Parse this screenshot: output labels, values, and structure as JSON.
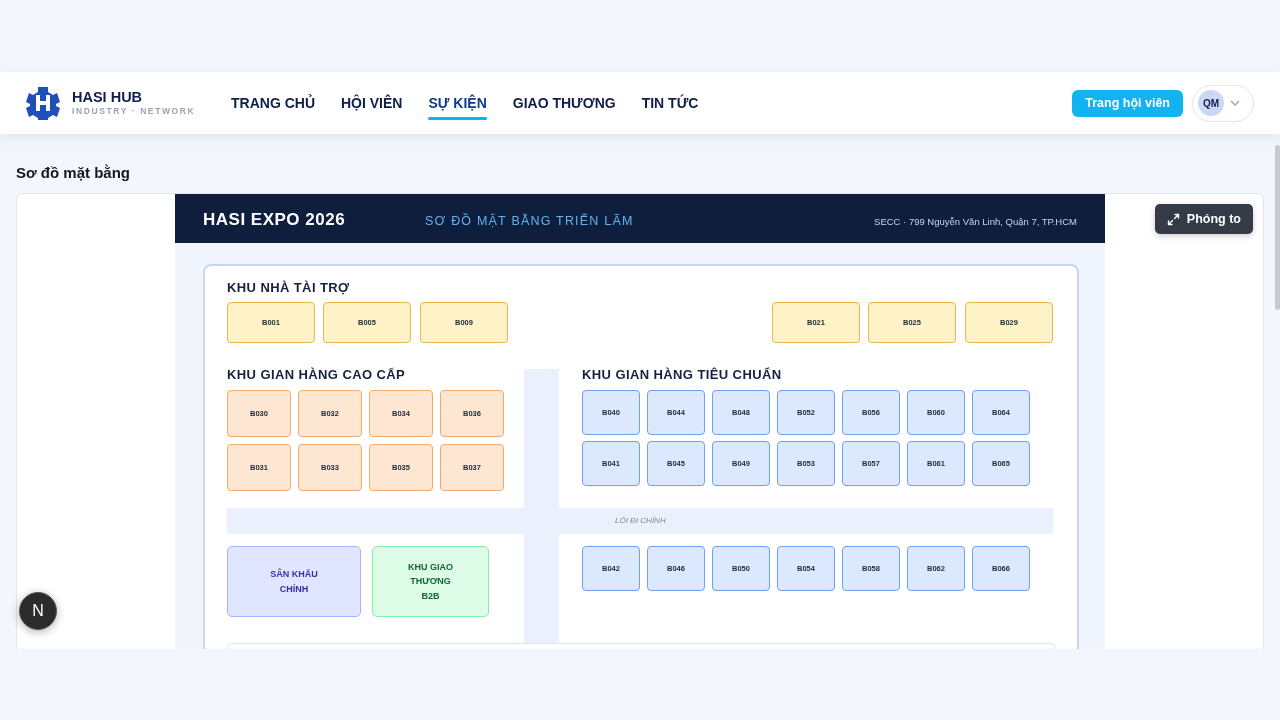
{
  "header": {
    "brand": "HASI HUB",
    "tagline": "INDUSTRY · NETWORK",
    "nav": [
      {
        "label": "TRANG CHỦ",
        "selected": false
      },
      {
        "label": "HỘI VIÊN",
        "selected": false
      },
      {
        "label": "SỰ KIỆN",
        "selected": true
      },
      {
        "label": "GIAO THƯƠNG",
        "selected": false
      },
      {
        "label": "TIN TỨC",
        "selected": false
      }
    ],
    "member_button": "Trang hội viên",
    "avatar": "QM"
  },
  "section_title": "Sơ đồ mặt bằng",
  "zoom_button": "Phóng to",
  "floor_plan": {
    "title": "HASI EXPO 2026",
    "subtitle": "SƠ ĐỒ MẶT BẰNG TRIỂN LÃM",
    "address": "SECC · 799 Nguyễn Văn Linh, Quận 7, TP.HCM",
    "zones": [
      {
        "kind": "sponsor",
        "title": "KHU NHÀ TÀI TRỢ",
        "booths": [
          "B001",
          "B005",
          "B009",
          "B021",
          "B025",
          "B029"
        ]
      },
      {
        "kind": "premium",
        "title": "KHU GIAN HÀNG CAO CẤP",
        "booths": [
          "B030",
          "B032",
          "B034",
          "B036",
          "B031",
          "B033",
          "B035",
          "B037"
        ]
      },
      {
        "kind": "standard",
        "title": "KHU GIAN HÀNG TIÊU CHUẨN",
        "booths": [
          "B040",
          "B044",
          "B048",
          "B052",
          "B056",
          "B060",
          "B064",
          "B041",
          "B045",
          "B049",
          "B053",
          "B057",
          "B061",
          "B065",
          "B042",
          "B046",
          "B050",
          "B054",
          "B058",
          "B062",
          "B066"
        ]
      }
    ],
    "aisle": "LỐI ĐI CHÍNH",
    "areas": [
      {
        "kind": "stage",
        "label": "SÂN KHẤU CHÍNH"
      },
      {
        "kind": "b2b",
        "label": "KHU GIAO THƯƠNG B2B"
      }
    ]
  },
  "dev_badge": "N"
}
